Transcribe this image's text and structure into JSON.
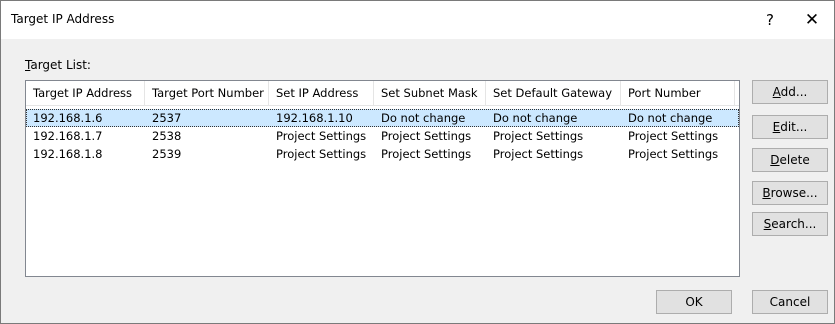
{
  "window": {
    "title": "Target IP Address",
    "help": "?",
    "close": "✕"
  },
  "target_list": {
    "label_mnemonic": "T",
    "label_rest": "arget List:",
    "columns": [
      "Target IP Address",
      "Target Port Number",
      "Set IP Address",
      "Set Subnet Mask",
      "Set Default Gateway",
      "Port Number"
    ],
    "rows": [
      [
        "192.168.1.6",
        "2537",
        "192.168.1.10",
        "Do not change",
        "Do not change",
        "Do not change"
      ],
      [
        "192.168.1.7",
        "2538",
        "Project Settings",
        "Project Settings",
        "Project Settings",
        "Project Settings"
      ],
      [
        "192.168.1.8",
        "2539",
        "Project Settings",
        "Project Settings",
        "Project Settings",
        "Project Settings"
      ]
    ],
    "selected_row": 0
  },
  "buttons": {
    "add": {
      "m": "A",
      "rest": "dd..."
    },
    "edit": {
      "m": "E",
      "rest": "dit..."
    },
    "delete": {
      "m": "D",
      "rest": "elete"
    },
    "browse": {
      "m": "B",
      "rest": "rowse..."
    },
    "search": {
      "m": "S",
      "rest": "earch..."
    },
    "ok": "OK",
    "cancel": "Cancel"
  }
}
